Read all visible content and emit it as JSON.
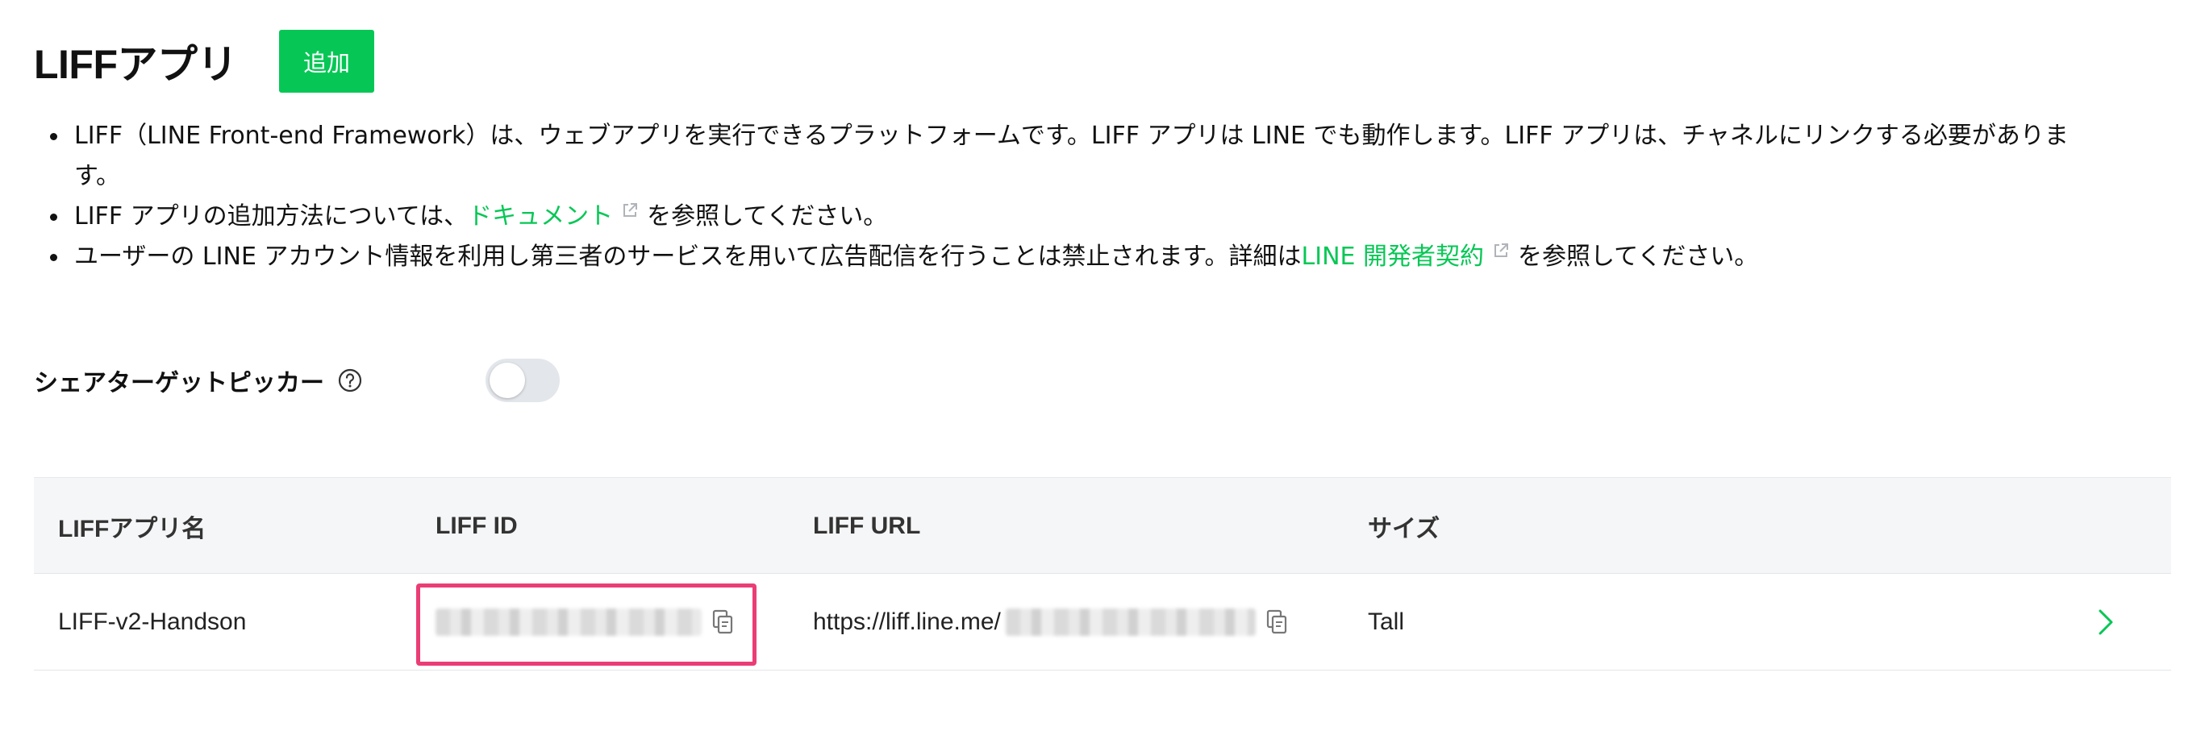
{
  "header": {
    "title": "LIFFアプリ",
    "add_label": "追加"
  },
  "notes": {
    "item1": "LIFF（LINE Front-end Framework）は、ウェブアプリを実行できるプラットフォームです。LIFF アプリは LINE でも動作します。LIFF アプリは、チャネルにリンクする必要がありま",
    "item1_cont": "す。",
    "item2_pre": "LIFF アプリの追加方法については、",
    "item2_link": "ドキュメント",
    "item2_post": "を参照してください。",
    "item3_pre": "ユーザーの LINE アカウント情報を利用し第三者のサービスを用いて広告配信を行うことは禁止されます。詳細は",
    "item3_link": "LINE 開発者契約",
    "item3_post": "を参照してください。"
  },
  "share_target_picker": {
    "label": "シェアターゲットピッカー",
    "enabled": false
  },
  "table": {
    "headers": [
      "LIFFアプリ名",
      "LIFF ID",
      "LIFF URL",
      "サイズ"
    ],
    "rows": [
      {
        "name": "LIFF-v2-Handson",
        "url_prefix": "https://liff.line.me/",
        "size": "Tall"
      }
    ]
  },
  "colors": {
    "accent": "#06c755",
    "highlight": "#ea3d76",
    "toggle_off": "#e3e6ea"
  },
  "icons": [
    "external-link-icon",
    "help-circle-icon",
    "copy-icon",
    "chevron-right-icon"
  ]
}
